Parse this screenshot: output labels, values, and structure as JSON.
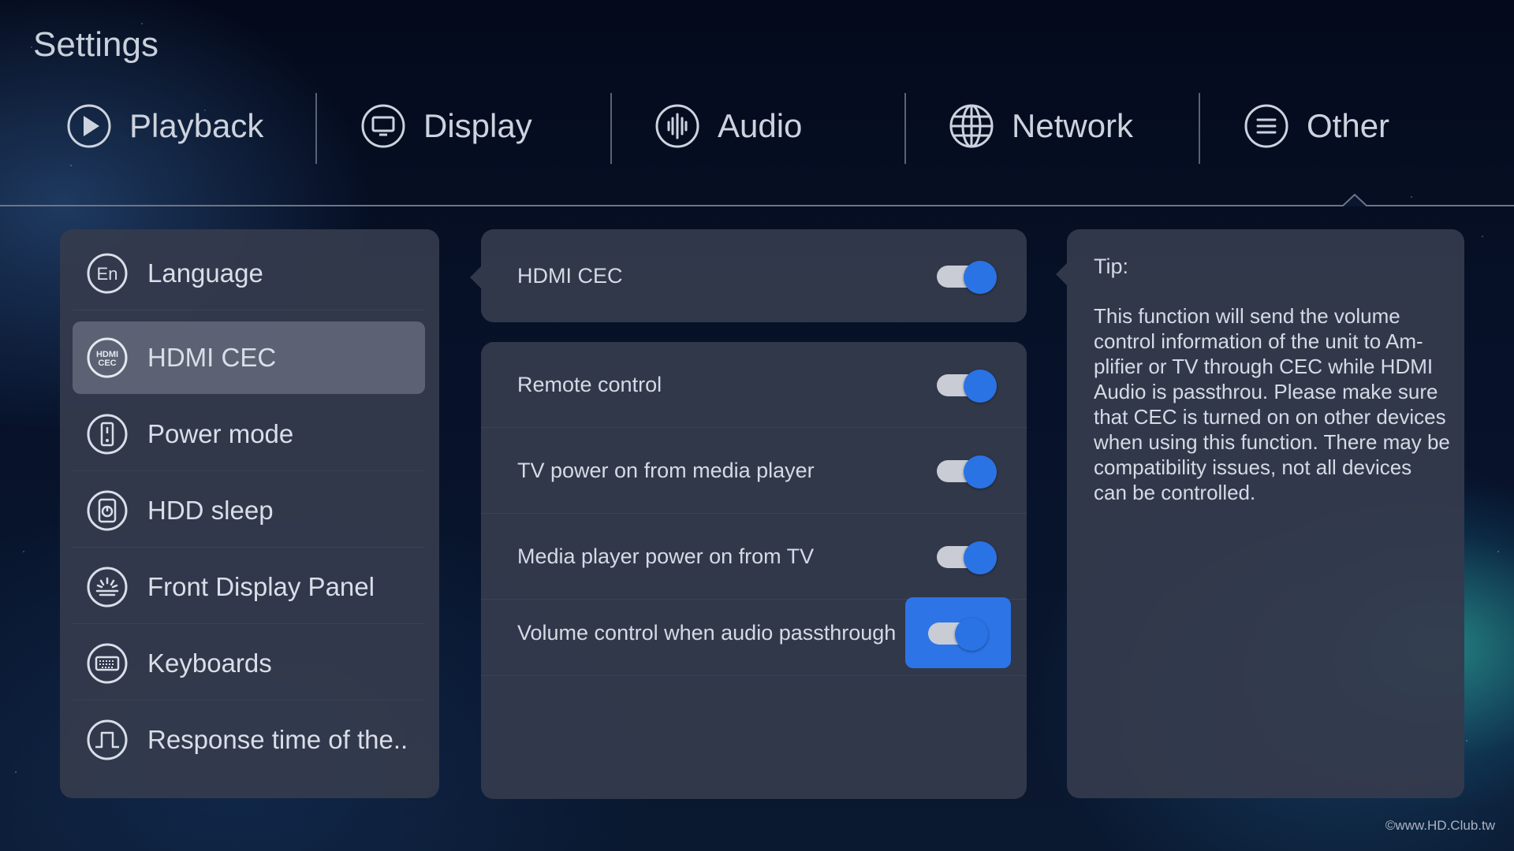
{
  "page": {
    "title": "Settings"
  },
  "tabs": [
    {
      "label": "Playback",
      "icon": "play-circle-icon"
    },
    {
      "label": "Display",
      "icon": "monitor-icon"
    },
    {
      "label": "Audio",
      "icon": "audio-wave-icon"
    },
    {
      "label": "Network",
      "icon": "globe-icon"
    },
    {
      "label": "Other",
      "icon": "menu-lines-icon"
    }
  ],
  "active_tab": "Other",
  "menu": {
    "selected": "HDMI CEC",
    "items": [
      {
        "label": "Language",
        "icon": "language-en-icon"
      },
      {
        "label": "HDMI CEC",
        "icon": "hdmi-cec-icon"
      },
      {
        "label": "Power mode",
        "icon": "power-mode-icon"
      },
      {
        "label": "HDD sleep",
        "icon": "hdd-sleep-icon"
      },
      {
        "label": "Front Display Panel",
        "icon": "front-display-icon"
      },
      {
        "label": "Keyboards",
        "icon": "keyboard-icon"
      },
      {
        "label": "Response time of the..",
        "icon": "response-time-icon"
      }
    ]
  },
  "icon_text": {
    "language": "En",
    "hdmi_top": "HDMI",
    "hdmi_bottom": "CEC"
  },
  "hdmi_cec": {
    "label": "HDMI CEC",
    "enabled": true
  },
  "options": [
    {
      "label": "Remote control",
      "enabled": true
    },
    {
      "label": "TV power on from media player",
      "enabled": true
    },
    {
      "label": "Media player power on from TV",
      "enabled": true
    },
    {
      "label": "Volume control when audio passthrough",
      "enabled": true,
      "focused": true
    }
  ],
  "tip": {
    "title": "Tip:",
    "body": "This function will send the volume control information of the unit to Am-plifier or TV through CEC while HDMI Audio is passthrou. Please make sure that CEC is turned on on other devices when using this function. There may be compatibility issues, not all devices can be controlled."
  },
  "watermark": "©www.HD.Club.tw",
  "colors": {
    "accent": "#2a73e5",
    "panel": "#343a4c",
    "selected_item": "#5c6273",
    "track": "#c9ccd4"
  }
}
